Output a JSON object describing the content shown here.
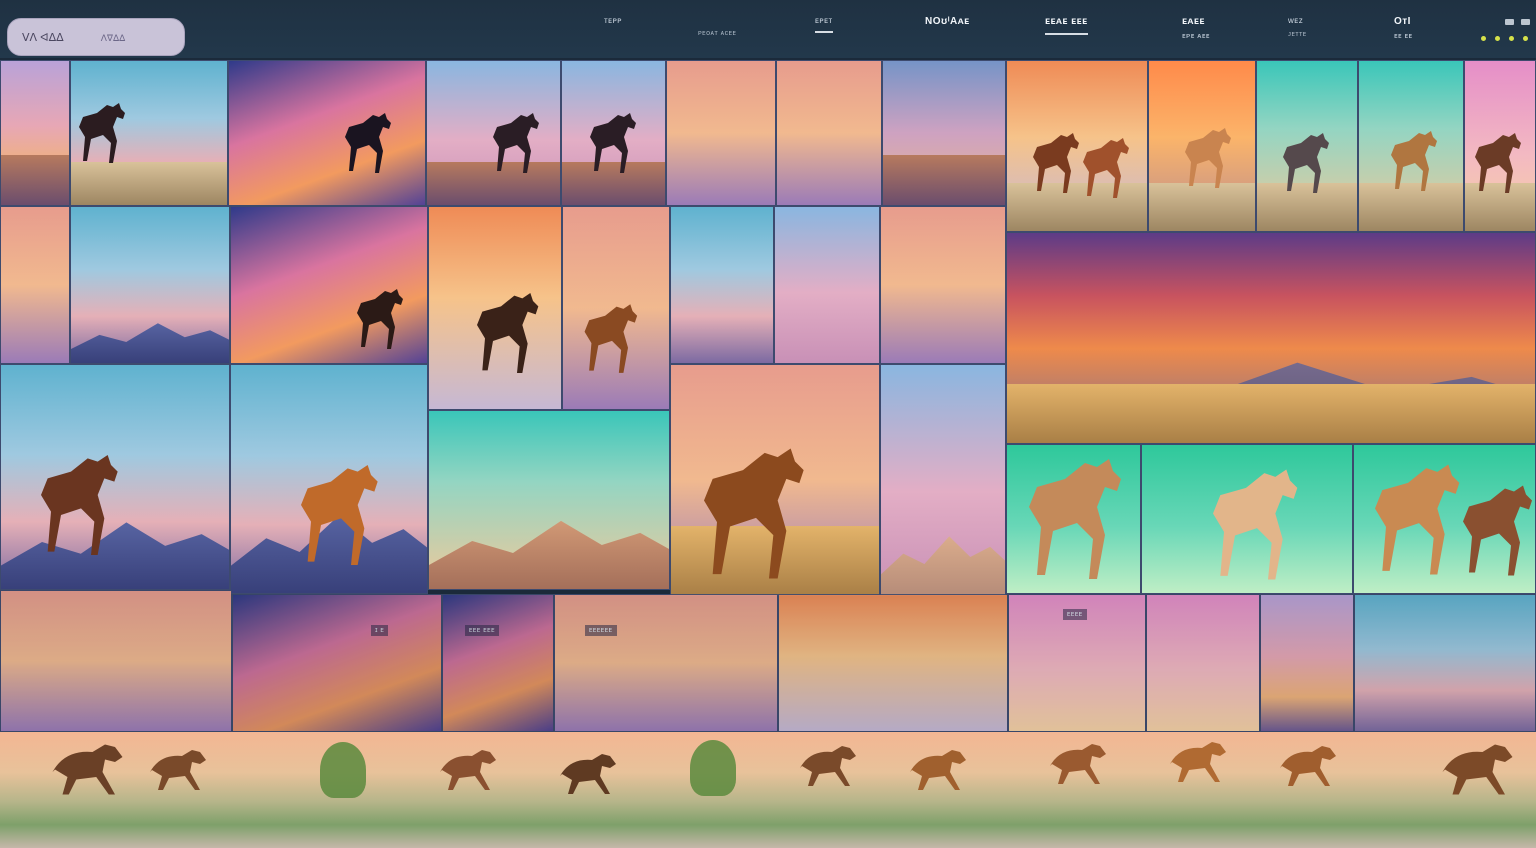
{
  "topbar": {
    "search": {
      "value": "ᐯᐱ ᐊᐃᐃ",
      "hint": "ᐱᐁᐃᐃ"
    },
    "nav": [
      {
        "label": "ᴛᴇᴘᴘ",
        "sub": ""
      },
      {
        "label": "",
        "sub": "ᴘᴇᴏᴀᴛ ᴀᴄᴇᴇ"
      },
      {
        "label": "ᴇᴘᴇᴛ",
        "sub": ""
      },
      {
        "label": "NOʊᴵAᴀᴇ",
        "sub": ""
      },
      {
        "label": "ᴇᴇᴀᴇ ᴇᴇᴇ",
        "sub": ""
      },
      {
        "label": "ᴇᴀᴇᴇ",
        "sub": "ᴇᴘᴇ ᴀᴇᴇ"
      },
      {
        "label": "ᴡᴇᴢ",
        "sub": "ᴊᴇᴛᴛᴇ"
      },
      {
        "label": "OᴛI",
        "sub": "ᴇᴇ ᴇᴇ"
      }
    ]
  },
  "chips": [
    {
      "text": "ɪ ᴇ"
    },
    {
      "text": "ᴇᴇᴇ ᴇᴇᴇ"
    },
    {
      "text": "ᴇᴇᴇᴇᴇᴇ"
    },
    {
      "text": "ᴇᴇᴇᴇ"
    }
  ],
  "colors": {
    "accent": "#d6e24a",
    "topbar": "#22384b",
    "search_bg": "#c9c3d8"
  },
  "icons": {
    "window_controls": "window-control-icon",
    "status_dots": "status-dot-icon",
    "horse": "horse-icon"
  }
}
